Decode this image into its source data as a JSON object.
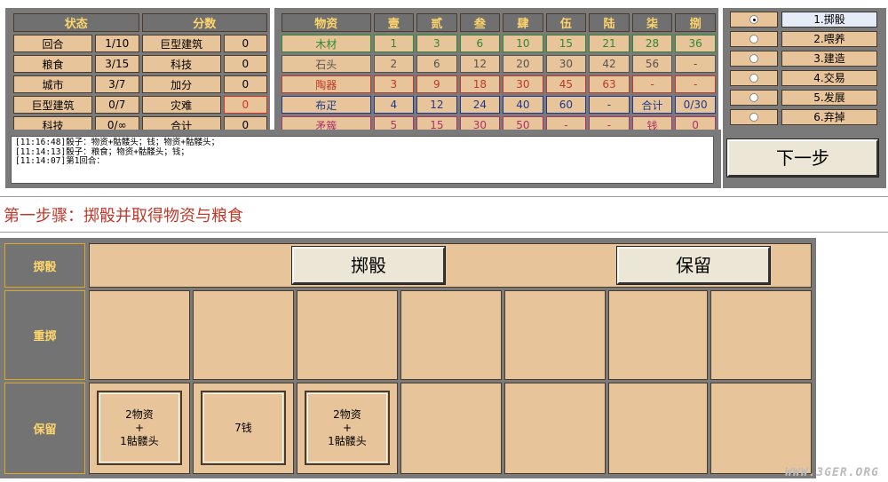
{
  "status": {
    "headers": [
      "状态",
      "分数"
    ],
    "rows": [
      {
        "label": "回合",
        "value": "1/10",
        "score_label": "巨型建筑",
        "score": "0"
      },
      {
        "label": "粮食",
        "value": "3/15",
        "score_label": "科技",
        "score": "0"
      },
      {
        "label": "城市",
        "value": "3/7",
        "score_label": "加分",
        "score": "0"
      },
      {
        "label": "巨型建筑",
        "value": "0/7",
        "score_label": "灾难",
        "score": "0"
      },
      {
        "label": "科技",
        "value": "0/∞",
        "score_label": "合计",
        "score": "0"
      }
    ]
  },
  "resources": {
    "headers": [
      "物资",
      "壹",
      "贰",
      "叁",
      "肆",
      "伍",
      "陆",
      "柒",
      "捌"
    ],
    "rows": [
      {
        "name": "木材",
        "cells": [
          "1",
          "3",
          "6",
          "10",
          "15",
          "21",
          "28",
          "36"
        ]
      },
      {
        "name": "石头",
        "cells": [
          "2",
          "6",
          "12",
          "20",
          "30",
          "42",
          "56",
          "-"
        ]
      },
      {
        "name": "陶器",
        "cells": [
          "3",
          "9",
          "18",
          "30",
          "45",
          "63",
          "-",
          "-"
        ]
      },
      {
        "name": "布疋",
        "cells": [
          "4",
          "12",
          "24",
          "40",
          "60",
          "-",
          "合计",
          "0/30"
        ]
      },
      {
        "name": "矛簇",
        "cells": [
          "5",
          "15",
          "30",
          "50",
          "-",
          "-",
          "钱",
          "0"
        ]
      }
    ]
  },
  "log": {
    "lines": [
      "[11:16:48]骰子：物资+骷髅头；钱；物资+骷髅头；",
      "[11:14:13]骰子：粮食；物资+骷髅头；钱；",
      "[11:14:07]第1回合："
    ]
  },
  "steps": {
    "items": [
      {
        "label": "1.掷骰",
        "selected": true
      },
      {
        "label": "2.喂养",
        "selected": false
      },
      {
        "label": "3.建造",
        "selected": false
      },
      {
        "label": "4.交易",
        "selected": false
      },
      {
        "label": "5.发展",
        "selected": false
      },
      {
        "label": "6.弃掉",
        "selected": false
      }
    ],
    "next_label": "下一步"
  },
  "title": "第一步骤：掷骰并取得物资与粮食",
  "board": {
    "roll_header": "掷骰",
    "reroll_header": "重掷",
    "keep_header": "保留",
    "roll_button": "掷骰",
    "keep_button": "保留",
    "kept_dice": [
      "2物资\n+\n1骷髅头",
      "7钱",
      "2物资\n+\n1骷髅头"
    ]
  },
  "watermark": "WWW.3GER.ORG",
  "colors": {
    "panel_bg": "#e8c49a",
    "frame": "#7a7a7a",
    "header_text": "#ffd66b",
    "title": "#c0392b"
  }
}
